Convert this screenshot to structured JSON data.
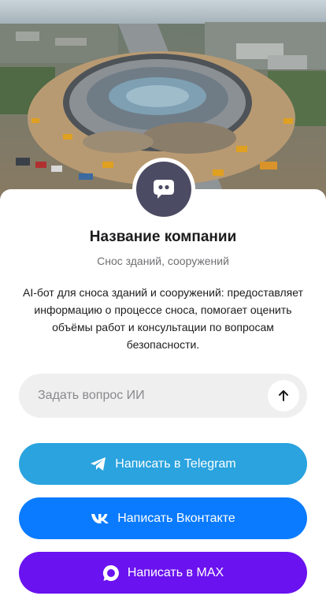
{
  "hero": {
    "image": "stadium-demolition-photo"
  },
  "profile": {
    "avatar_icon": "chat-bubble-icon",
    "company_name": "Название компании",
    "subtitle": "Снос зданий, сооружений",
    "description": "AI-бот для сноса зданий и сооружений: предоставляет информацию о процессе сноса, помогает оценить объёмы работ и консультации по вопросам безопасности."
  },
  "ask": {
    "placeholder": "Задать вопрос ИИ",
    "value": "",
    "send_icon": "arrow-up-icon"
  },
  "buttons": {
    "telegram": {
      "label": "Написать в Telegram",
      "icon": "telegram-icon",
      "color": "#2aa3df"
    },
    "vk": {
      "label": "Написать Вконтакте",
      "icon": "vk-icon",
      "color": "#0a7bff"
    },
    "max": {
      "label": "Написать в MAX",
      "icon": "max-icon",
      "color": "#6a12f0"
    }
  }
}
